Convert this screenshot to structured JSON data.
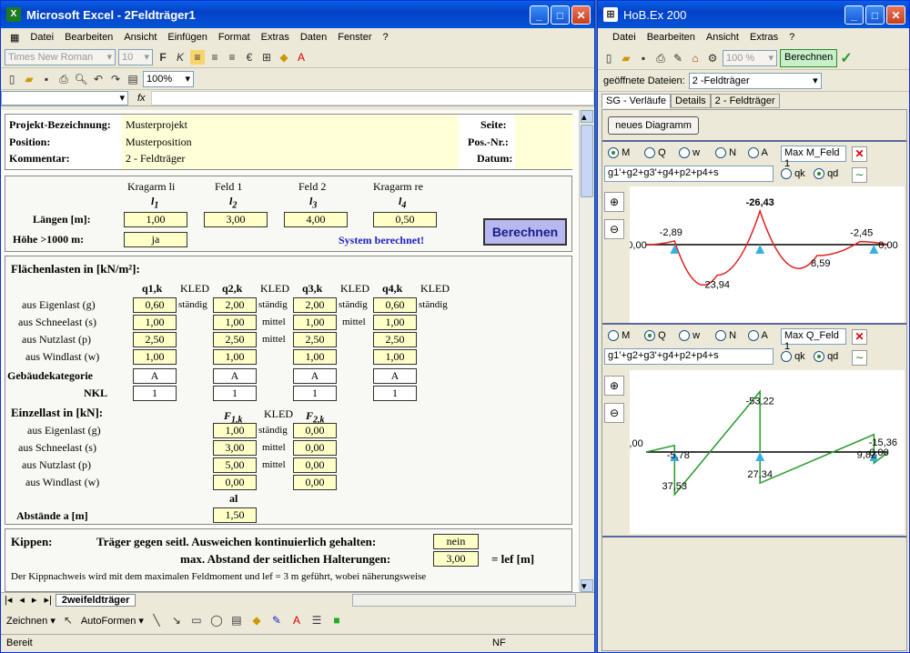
{
  "excel": {
    "title": "Microsoft Excel - 2Feldträger1",
    "menu": [
      "Datei",
      "Bearbeiten",
      "Ansicht",
      "Einfügen",
      "Format",
      "Extras",
      "Daten",
      "Fenster",
      "?"
    ],
    "font": "Times New Roman",
    "size": "10",
    "zoom": "100%",
    "project": {
      "bez_label": "Projekt-Bezeichnung:",
      "bez": "Musterprojekt",
      "pos_label": "Position:",
      "pos": "Musterposition",
      "kom_label": "Kommentar:",
      "kom": "2 - Feldträger",
      "seite": "Seite:",
      "posnr": "Pos.-Nr.:",
      "datum": "Datum:"
    },
    "spans": {
      "h1": "Kragarm li",
      "h2": "Feld 1",
      "h3": "Feld 2",
      "h4": "Kragarm re",
      "l1": "l",
      "l2": "l",
      "l3": "l",
      "l4": "l",
      "s1": "1",
      "s2": "2",
      "s3": "3",
      "s4": "4",
      "laengen": "Längen [m]:",
      "v1": "1,00",
      "v2": "3,00",
      "v3": "4,00",
      "v4": "0,50",
      "hoehe": "Höhe >1000 m:",
      "hoehe_val": "ja",
      "system": "System berechnet!",
      "btn": "Berechnen"
    },
    "flaeche": {
      "title": "Flächenlasten in [kN/m²]:",
      "q1": "q1,k",
      "q2": "q2,k",
      "q3": "q3,k",
      "q4": "q4,k",
      "kled": "KLED",
      "rows": [
        {
          "label": "aus Eigenlast (g)",
          "v": [
            "0,60",
            "2,00",
            "2,00",
            "0,60"
          ],
          "k": [
            "ständig",
            "ständig",
            "ständig",
            "ständig"
          ]
        },
        {
          "label": "aus Schneelast (s)",
          "v": [
            "1,00",
            "1,00",
            "1,00",
            "1,00"
          ],
          "k": [
            "",
            "mittel",
            "mittel",
            ""
          ]
        },
        {
          "label": "aus Nutzlast (p)",
          "v": [
            "2,50",
            "2,50",
            "2,50",
            "2,50"
          ],
          "k": [
            "",
            "mittel",
            "",
            ""
          ]
        },
        {
          "label": "aus Windlast (w)",
          "v": [
            "1,00",
            "1,00",
            "1,00",
            "1,00"
          ],
          "k": [
            "",
            "",
            "",
            ""
          ]
        }
      ],
      "geb": "Gebäudekategorie",
      "geb_v": [
        "A",
        "A",
        "A",
        "A"
      ],
      "nkl": "NKL",
      "nkl_v": [
        "1",
        "1",
        "1",
        "1"
      ]
    },
    "einzel": {
      "title": "Einzellast in [kN]:",
      "f1": "F",
      "f1s": "1,k",
      "f2": "F",
      "f2s": "2,k",
      "kled": "KLED",
      "rows": [
        {
          "label": "aus Eigenlast (g)",
          "a": "1,00",
          "k": "ständig",
          "b": "0,00"
        },
        {
          "label": "aus Schneelast (s)",
          "a": "3,00",
          "k": "mittel",
          "b": "0,00"
        },
        {
          "label": "aus Nutzlast (p)",
          "a": "5,00",
          "k": "mittel",
          "b": "0,00"
        },
        {
          "label": "aus Windlast (w)",
          "a": "0,00",
          "k": "",
          "b": "0,00"
        }
      ],
      "al": "al",
      "abst": "Abstände a [m]",
      "abst_v": "1,50"
    },
    "kippen": {
      "title": "Kippen:",
      "line1": "Träger gegen seitl. Ausweichen kontinuierlich gehalten:",
      "v1": "nein",
      "line2": "max. Abstand der seitlichen Halterungen:",
      "v2": "3,00",
      "unit": "= lef [m]",
      "note": "Der Kippnachweis wird mit dem maximalen Feldmoment und lef = 3 m geführt, wobei näherungsweise"
    },
    "sheet_tab": "2weifeldträger",
    "draw": [
      "Zeichnen",
      "AutoFormen"
    ],
    "status": "Bereit",
    "nf": "NF"
  },
  "hob": {
    "title": "HoB.Ex 200",
    "menu": [
      "Datei",
      "Bearbeiten",
      "Ansicht",
      "Extras",
      "?"
    ],
    "zoom": "100 %",
    "berechnen": "Berechnen",
    "files_label": "geöffnete Dateien:",
    "files_val": "2 -Feldträger",
    "tabs": [
      "SG - Verläufe",
      "Details",
      "2 - Feldträger"
    ],
    "new_diag": "neues Diagramm",
    "radios": [
      "M",
      "Q",
      "w",
      "N",
      "A"
    ],
    "d1": {
      "max": "Max M_Feld 1",
      "combo": "g1'+g2+g3'+g4+p2+p4+s",
      "qk": "qk",
      "qd": "qd"
    },
    "d2": {
      "max": "Max Q_Feld 1",
      "combo": "g1'+g2+g3'+g4+p2+p4+s",
      "qk": "qk",
      "qd": "qd"
    },
    "colors": {
      "moment": "#e02020",
      "shear": "#2a9a2a",
      "support": "#3ab0e0"
    }
  },
  "chart_data": [
    {
      "type": "line",
      "name": "M",
      "x": [
        0,
        1,
        2.5,
        4,
        6,
        7.5,
        8.5
      ],
      "series": [
        {
          "values": [
            0,
            -2.89,
            23.94,
            -26.43,
            8.59,
            -2.45,
            0
          ]
        }
      ],
      "labels": [
        "0,00",
        "-2,89",
        "23,94",
        "-26,43",
        "8,59",
        "-2,45",
        "0,00"
      ]
    },
    {
      "type": "line",
      "name": "Q",
      "x": [
        0,
        1,
        1,
        4,
        4,
        8,
        8,
        8.5
      ],
      "series": [
        {
          "values": [
            0,
            -5.78,
            37.53,
            -53.22,
            27.34,
            -15.36,
            9.82,
            0
          ]
        }
      ],
      "labels": [
        "0,00",
        "-5,78",
        "37,53",
        "-53,22",
        "27,34",
        "-15,36",
        "9,82",
        "0,00"
      ]
    }
  ]
}
